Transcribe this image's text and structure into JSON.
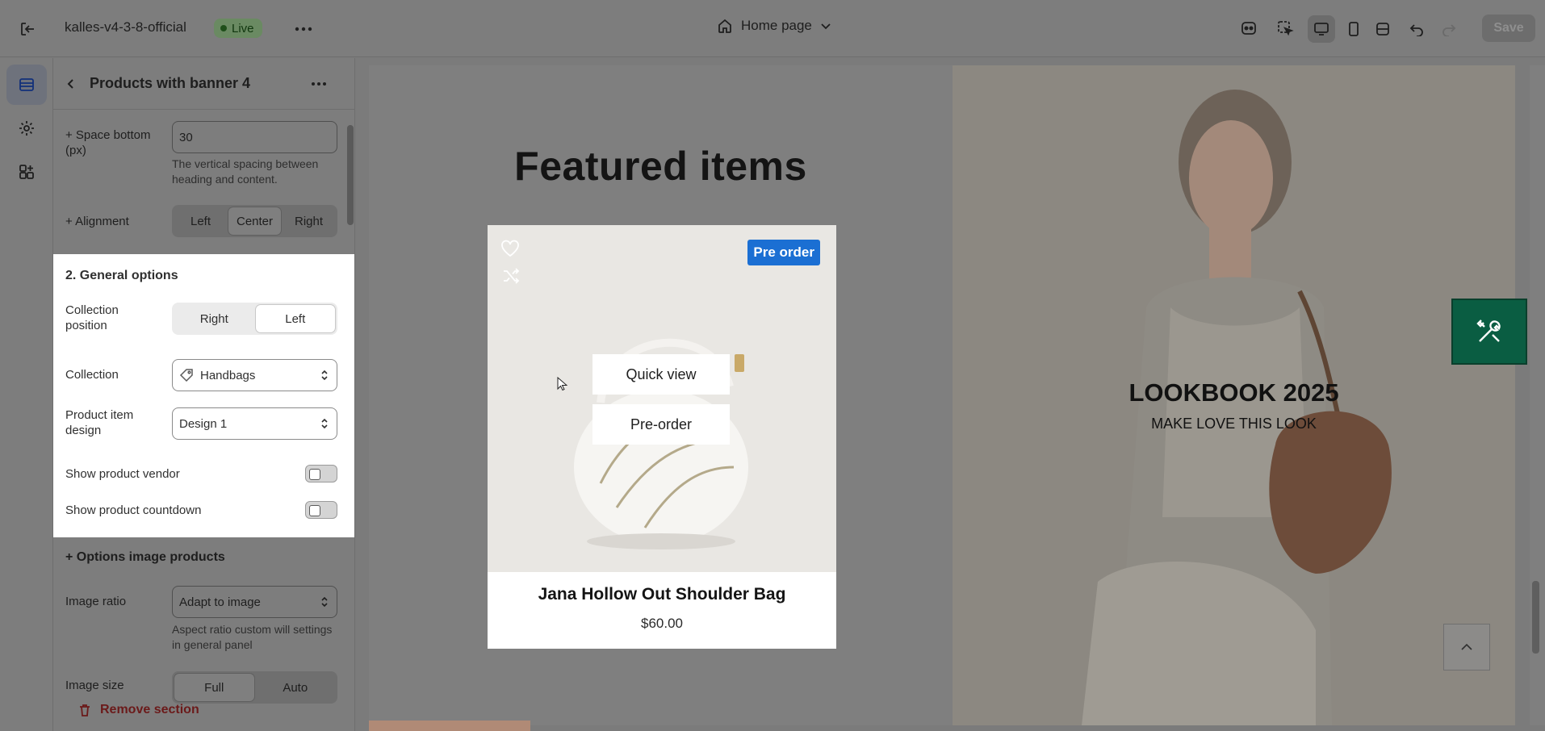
{
  "topbar": {
    "store_name": "kalles-v4-3-8-official",
    "status": "Live",
    "page": "Home page",
    "save_label": "Save"
  },
  "panel": {
    "title": "Products with banner 4",
    "space_bottom": {
      "label": "+ Space bottom (px)",
      "value": "30",
      "help": "The vertical spacing between heading and content."
    },
    "alignment": {
      "label": "+ Alignment",
      "options": [
        "Left",
        "Center",
        "Right"
      ],
      "selected": "Center"
    },
    "general": {
      "heading": "2. General options",
      "collection_position": {
        "label": "Collection position",
        "options": [
          "Right",
          "Left"
        ],
        "selected": "Left"
      },
      "collection": {
        "label": "Collection",
        "value": "Handbags"
      },
      "product_item_design": {
        "label": "Product item design",
        "value": "Design 1"
      },
      "show_vendor": {
        "label": "Show product vendor",
        "checked": false
      },
      "show_countdown": {
        "label": "Show product countdown",
        "checked": false
      }
    },
    "options_image": {
      "heading": "+ Options image products",
      "image_ratio": {
        "label": "Image ratio",
        "value": "Adapt to image",
        "help": "Aspect ratio custom will settings in general panel"
      },
      "image_size": {
        "label": "Image size",
        "options": [
          "Full",
          "Auto"
        ]
      }
    },
    "remove_label": "Remove section"
  },
  "preview": {
    "featured_title": "Featured items",
    "product": {
      "badge": "Pre order",
      "quick_view": "Quick view",
      "pre_order": "Pre-order",
      "name": "Jana Hollow Out Shoulder Bag",
      "price": "$60.00"
    },
    "banner": {
      "title": "LOOKBOOK 2025",
      "subtitle": "MAKE LOVE THIS LOOK"
    }
  },
  "colors": {
    "badge_blue": "#1b6fd3",
    "tools_green": "#0a5d42",
    "remove_red": "#8e1f1f"
  }
}
